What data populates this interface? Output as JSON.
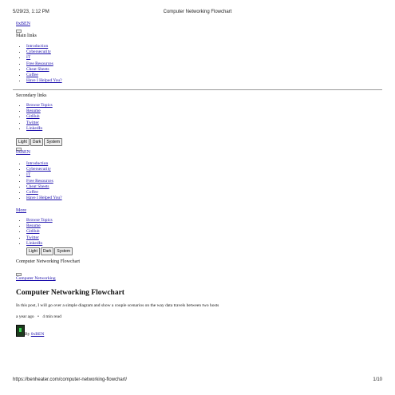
{
  "print_header": {
    "datetime": "5/29/23, 1:12 PM",
    "title": "Computer Networking Flowchart"
  },
  "print_footer": {
    "url": "https://benheater.com/computer-networking-flowchart/",
    "page": "1/10"
  },
  "site": {
    "name": "0xBEN"
  },
  "main_links": {
    "heading": "Main links",
    "items": [
      "Introduction",
      "Cybersecurity",
      "IT",
      "Free Resources",
      "Cheat Sheets",
      "Coffee",
      "Have I Helped You?"
    ]
  },
  "secondary_links": {
    "heading": "Secondary links",
    "items": [
      "Browse Topics",
      "Resume",
      "GitHub",
      "Twitter",
      "LinkedIn"
    ]
  },
  "theme_buttons": [
    "Light",
    "Dark",
    "System"
  ],
  "more_label": "More",
  "page_title_text": "Computer Networking Flowchart",
  "article": {
    "tag": "Computer Networking",
    "title": "Computer Networking Flowchart",
    "excerpt": "In this post, I will go over a simple diagram and show a couple scenarios on the way data travels between two hosts",
    "age": "a year ago",
    "separator": "•",
    "read_time": "4 min read",
    "byline_prefix": "By",
    "author": "0xBEN"
  }
}
